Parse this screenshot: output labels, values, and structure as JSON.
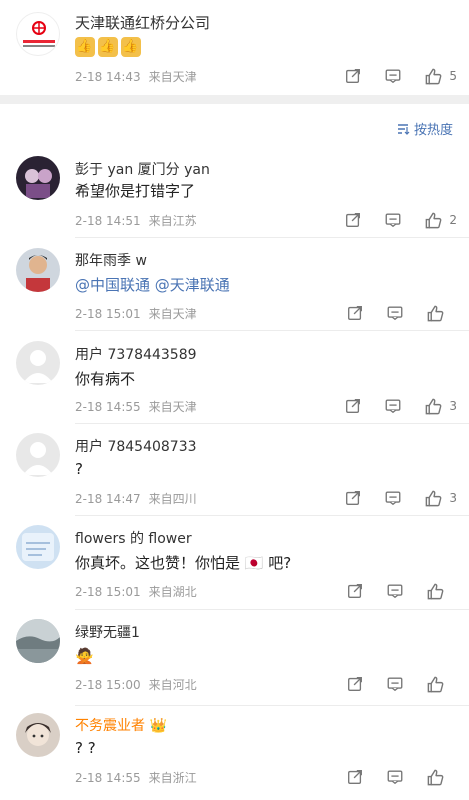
{
  "top": {
    "name": "天津联通红桥分公司",
    "thumbs": [
      "👍",
      "👍",
      "👍"
    ],
    "time": "2-18 14:43",
    "location": "来自天津",
    "likes": "5",
    "logo_text": "China unicom中国联通"
  },
  "sort_label": "按热度",
  "comments": [
    {
      "name": "彭于 yan 厦门分 yan",
      "text": "希望你是打错字了",
      "time": "2-18 14:51",
      "location": "来自江苏",
      "likes": "2"
    },
    {
      "name": "那年雨季 w",
      "mention1": "@中国联通",
      "mention2": "@天津联通",
      "time": "2-18 15:01",
      "location": "来自天津",
      "likes": ""
    },
    {
      "name": "用户 7378443589",
      "text": "你有病不",
      "time": "2-18 14:55",
      "location": "来自天津",
      "likes": "3"
    },
    {
      "name": "用户 7845408733",
      "text": "?",
      "time": "2-18 14:47",
      "location": "来自四川",
      "likes": "3"
    },
    {
      "name": "flowers 的 flower",
      "text": "你真坏。这也赞！你怕是 🇯🇵 吧?",
      "time": "2-18 15:01",
      "location": "来自湖北",
      "likes": ""
    },
    {
      "name": "绿野无疆1",
      "text": "🙅",
      "time": "2-18 15:00",
      "location": "来自河北",
      "likes": ""
    },
    {
      "name": "不务震业者",
      "badge": "👑",
      "text": "? ?",
      "time": "2-18 14:55",
      "location": "来自浙江",
      "likes": ""
    }
  ],
  "colors": {
    "link": "#4a74b4",
    "vip_name": "#ff8200",
    "meta": "#9a9a9a"
  }
}
